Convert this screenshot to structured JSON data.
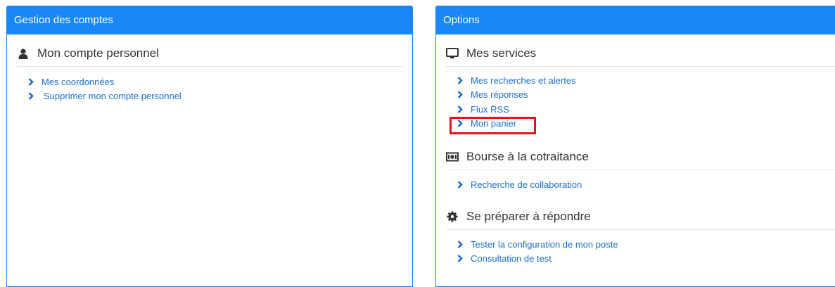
{
  "left_panel": {
    "header": "Gestion des comptes",
    "section": {
      "title": "Mon compte personnel",
      "icon": "user-icon",
      "links": [
        "Mes coordonnées",
        "Supprimer mon compte personnel"
      ]
    }
  },
  "right_panel": {
    "header": "Options",
    "sections": [
      {
        "title": "Mes services",
        "icon": "monitor-icon",
        "links": [
          "Mes recherches et alertes",
          "Mes réponses",
          "Flux RSS",
          "Mon panier"
        ]
      },
      {
        "title": "Bourse à la cotraitance",
        "icon": "banknote-icon",
        "links": [
          "Recherche de collaboration"
        ]
      },
      {
        "title": "Se préparer à répondre",
        "icon": "gear-icon",
        "links": [
          "Tester la configuration de mon poste",
          "Consultation de test"
        ]
      }
    ]
  },
  "highlighted_item": "Mon panier",
  "colors": {
    "header_bg": "#1a87f5",
    "link": "#1a6fd0",
    "highlight": "#e0141a"
  }
}
